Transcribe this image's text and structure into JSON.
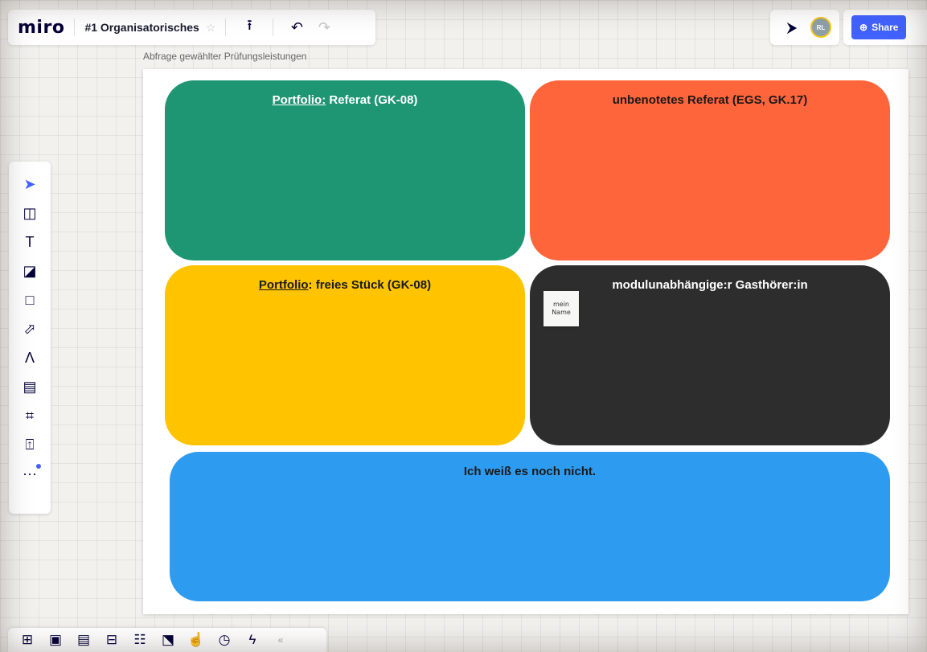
{
  "app": {
    "logo": "miro",
    "board_title": "#1 Organisatorisches",
    "star": "☆"
  },
  "toolbar_top": {
    "export_icon": "⭱",
    "undo_icon": "↶",
    "redo_icon": "↷",
    "cursor_icon": "⮞",
    "avatar_initials": "RL",
    "share_globe": "⊕",
    "share_label": "Share"
  },
  "frame": {
    "label": "Abfrage gewählter Prüfungsleistungen"
  },
  "cards": {
    "green": {
      "prefix": "Portfolio:",
      "rest": " Referat (GK-08)"
    },
    "orange": {
      "title": "unbenotetes Referat (EGS, GK.17)"
    },
    "yellow": {
      "prefix": "Portfolio",
      "rest": ": freies Stück (GK-08)"
    },
    "dark": {
      "title": "modulunabhängige:r Gasthörer:in"
    },
    "blue": {
      "title": "Ich weiß es noch nicht."
    }
  },
  "sticky": {
    "line1": "mein",
    "line2": "Name"
  },
  "left_tools": {
    "select": "➤",
    "templates": "◫",
    "text": "T",
    "sticky_note": "◪",
    "shape": "□",
    "connector": "⬀",
    "pen": "Λ",
    "comment": "▤",
    "frame": "⌗",
    "upload": "⍐",
    "more": "···"
  },
  "bottom_tools": {
    "b1": "⊞",
    "b2": "▣",
    "b3": "▤",
    "b4": "⊟",
    "b5": "☷",
    "b6": "⬔",
    "b7": "☝",
    "b8": "◷",
    "b9": "ϟ",
    "collapse": "«"
  },
  "colors": {
    "green": "#1f9673",
    "orange": "#ff653b",
    "yellow": "#ffc300",
    "dark": "#2d2d2d",
    "blue": "#2d9bf0",
    "accent": "#4262ff"
  }
}
